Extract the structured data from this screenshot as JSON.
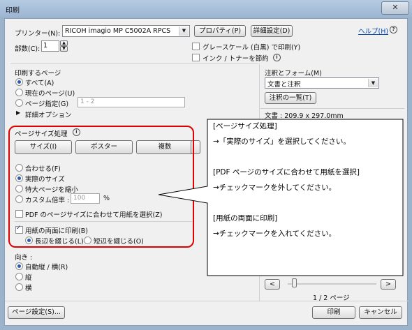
{
  "window": {
    "title": "印刷",
    "close_glyph": "✕"
  },
  "printer": {
    "label": "プリンター(N):",
    "value": "RICOH imagio MP C5002A RPCS",
    "properties": "プロパティ(P)",
    "advanced": "詳細設定(D)",
    "help": "ヘルプ(H)"
  },
  "copies": {
    "label": "部数(C):",
    "value": "1"
  },
  "options": {
    "grayscale": "グレースケール (白黒) で印刷(Y)",
    "save_ink": "インク / トナーを節約"
  },
  "pages": {
    "heading": "印刷するページ",
    "all": "すべて(A)",
    "current": "現在のページ(U)",
    "range": "ページ指定(G)",
    "range_value": "1 - 2",
    "more": "詳細オプション"
  },
  "sizing": {
    "heading": "ページサイズ処理",
    "tabs": [
      "サイズ(I)",
      "ポスター",
      "複数"
    ],
    "fit": "合わせる(F)",
    "actual": "実際のサイズ",
    "shrink": "特大ページを縮小",
    "custom": "カスタム倍率 :",
    "custom_value": "100",
    "percent": "%",
    "pdf_paper": "PDF のページサイズに合わせて用紙を選択(Z)",
    "duplex": "用紙の両面に印刷(B)",
    "long_edge": "長辺を綴じる(L)",
    "short_edge": "短辺を綴じる(O)"
  },
  "orientation": {
    "heading": "向き :",
    "auto": "自動縦 / 横(R)",
    "portrait": "縦",
    "landscape": "横"
  },
  "annotations": {
    "heading": "注釈とフォーム(M)",
    "value": "文書と注釈",
    "summary_button": "注釈の一覧(T)",
    "doc_size": "文書 : 209.9 x 297.0mm"
  },
  "preview": {
    "prev": "<",
    "next": ">",
    "page_indicator": "1 / 2 ページ"
  },
  "footer": {
    "page_setup": "ページ設定(S)...",
    "print": "印刷",
    "cancel": "キャンセル"
  },
  "callout": {
    "line1": "[ページサイズ処理]",
    "line2": "→「実際のサイズ」を選択してください。",
    "line3": "[PDF ページのサイズに合わせて用紙を選択]",
    "line4": "→チェックマークを外してください。",
    "line5": "[用紙の両面に印刷]",
    "line6": "→チェックマークを入れてください。"
  },
  "colors": {
    "highlight": "#e00000",
    "titlebar": "#b6cbe2",
    "dialog_bg": "#f0f0f0"
  }
}
